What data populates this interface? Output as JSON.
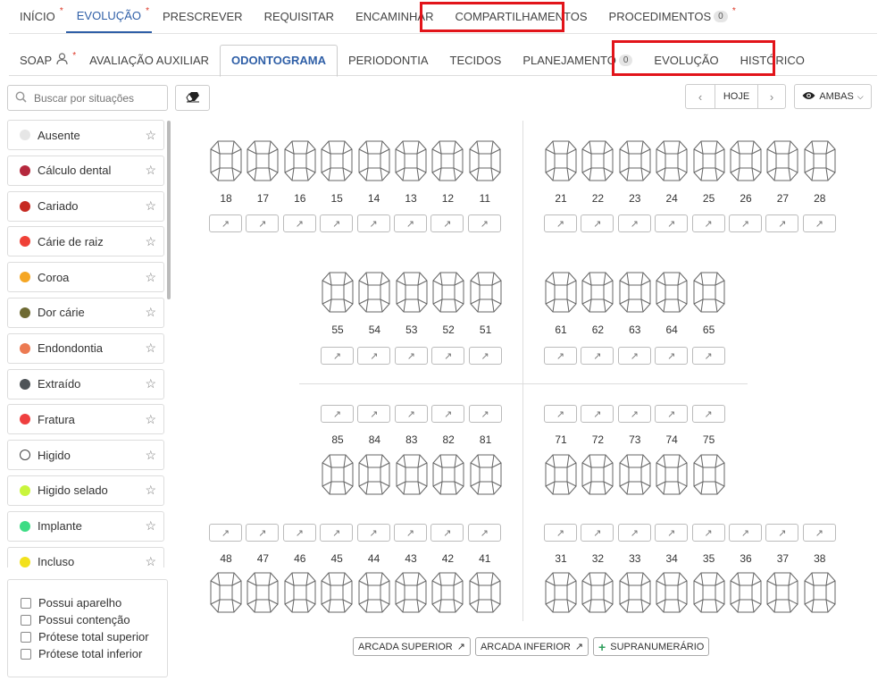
{
  "top_tabs": [
    {
      "label": "INÍCIO",
      "asterisk": true
    },
    {
      "label": "EVOLUÇÃO",
      "asterisk": true,
      "active": true
    },
    {
      "label": "PRESCREVER"
    },
    {
      "label": "REQUISITAR"
    },
    {
      "label": "ENCAMINHAR"
    },
    {
      "label": "COMPARTILHAMENTOS"
    },
    {
      "label": "PROCEDIMENTOS",
      "badge": "0",
      "asterisk": true
    }
  ],
  "sub_tabs": [
    {
      "label": "SOAP",
      "asterisk": true
    },
    {
      "label": "AVALIAÇÃO AUXILIAR"
    },
    {
      "label": "ODONTOGRAMA",
      "active": true
    },
    {
      "label": "PERIODONTIA"
    },
    {
      "label": "TECIDOS"
    },
    {
      "label": "PLANEJAMENTO",
      "badge": "0"
    },
    {
      "label": "EVOLUÇÃO"
    },
    {
      "label": "HISTÓRICO"
    }
  ],
  "search": {
    "placeholder": "Buscar por situações"
  },
  "date_nav": {
    "today": "HOJE"
  },
  "view_select": {
    "label": "AMBAS"
  },
  "situations": [
    {
      "label": "Ausente",
      "color": "#e6e6e6"
    },
    {
      "label": "Cálculo dental",
      "color": "#b5283d"
    },
    {
      "label": "Cariado",
      "color": "#c62a22"
    },
    {
      "label": "Cárie de raiz",
      "color": "#ef4137"
    },
    {
      "label": "Coroa",
      "color": "#f5a623"
    },
    {
      "label": "Dor cárie",
      "color": "#6e6a32"
    },
    {
      "label": "Endondontia",
      "color": "#ec7a52"
    },
    {
      "label": "Extraído",
      "color": "#4e5458"
    },
    {
      "label": "Fratura",
      "color": "#ef3f3f"
    },
    {
      "label": "Higido",
      "color": "#ffffff"
    },
    {
      "label": "Higido selado",
      "color": "#c9f53c"
    },
    {
      "label": "Implante",
      "color": "#3ddc84"
    },
    {
      "label": "Incluso",
      "color": "#f2e11d"
    }
  ],
  "checkboxes": [
    {
      "label": "Possui aparelho"
    },
    {
      "label": "Possui contenção"
    },
    {
      "label": "Prótese total superior"
    },
    {
      "label": "Prótese total inferior"
    }
  ],
  "teeth": {
    "upper_right": [
      "18",
      "17",
      "16",
      "15",
      "14",
      "13",
      "12",
      "11"
    ],
    "upper_left": [
      "21",
      "22",
      "23",
      "24",
      "25",
      "26",
      "27",
      "28"
    ],
    "deciduous_upper_right": [
      "55",
      "54",
      "53",
      "52",
      "51"
    ],
    "deciduous_upper_left": [
      "61",
      "62",
      "63",
      "64",
      "65"
    ],
    "deciduous_lower_right": [
      "85",
      "84",
      "83",
      "82",
      "81"
    ],
    "deciduous_lower_left": [
      "71",
      "72",
      "73",
      "74",
      "75"
    ],
    "lower_right": [
      "48",
      "47",
      "46",
      "45",
      "44",
      "43",
      "42",
      "41"
    ],
    "lower_left": [
      "31",
      "32",
      "33",
      "34",
      "35",
      "36",
      "37",
      "38"
    ]
  },
  "bottom_buttons": {
    "arcada_superior": "ARCADA SUPERIOR",
    "arcada_inferior": "ARCADA INFERIOR",
    "supranumerario": "SUPRANUMERÁRIO"
  }
}
